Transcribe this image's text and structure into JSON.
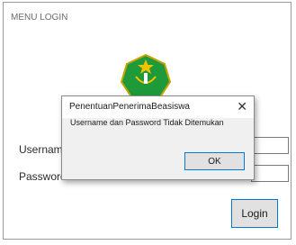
{
  "window": {
    "title": "MENU LOGIN"
  },
  "form": {
    "username_label": "Username",
    "password_label": "Password",
    "username_value": "",
    "password_value": "",
    "login_label": "Login"
  },
  "dialog": {
    "title": "PenentuanPenerimaBeasiswa",
    "close_glyph": "✕",
    "message": "Username dan Password Tidak Ditemukan",
    "ok_label": "OK"
  },
  "colors": {
    "accent_border": "#0078d7",
    "logo_green": "#1f9a3a",
    "logo_yellow": "#f2c200"
  },
  "icons": {
    "logo": "ministry-emblem-icon"
  }
}
